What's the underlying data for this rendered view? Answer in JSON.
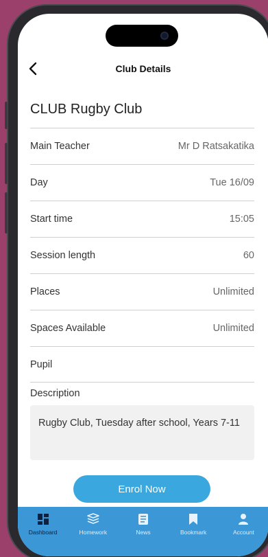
{
  "nav": {
    "title": "Club Details"
  },
  "club_title": "CLUB Rugby Club",
  "details": [
    {
      "label": "Main Teacher",
      "value": "Mr D Ratsakatika"
    },
    {
      "label": "Day",
      "value": "Tue 16/09"
    },
    {
      "label": "Start time",
      "value": "15:05"
    },
    {
      "label": "Session length",
      "value": "60"
    },
    {
      "label": "Places",
      "value": "Unlimited"
    },
    {
      "label": "Spaces Available",
      "value": "Unlimited"
    }
  ],
  "pupil_label": "Pupil",
  "description": {
    "label": "Description",
    "text": "Rugby Club, Tuesday after school, Years 7-11"
  },
  "enrol_button": "Enrol Now",
  "tabs": [
    {
      "label": "Dashboard",
      "icon": "dashboard-icon",
      "active": true
    },
    {
      "label": "Homework",
      "icon": "homework-icon",
      "active": false
    },
    {
      "label": "News",
      "icon": "news-icon",
      "active": false
    },
    {
      "label": "Bookmark",
      "icon": "bookmark-icon",
      "active": false
    },
    {
      "label": "Account",
      "icon": "account-icon",
      "active": false
    }
  ],
  "colors": {
    "accent": "#3aa8de",
    "tabbar": "#3b97d6",
    "background": "#9b3f6b"
  }
}
